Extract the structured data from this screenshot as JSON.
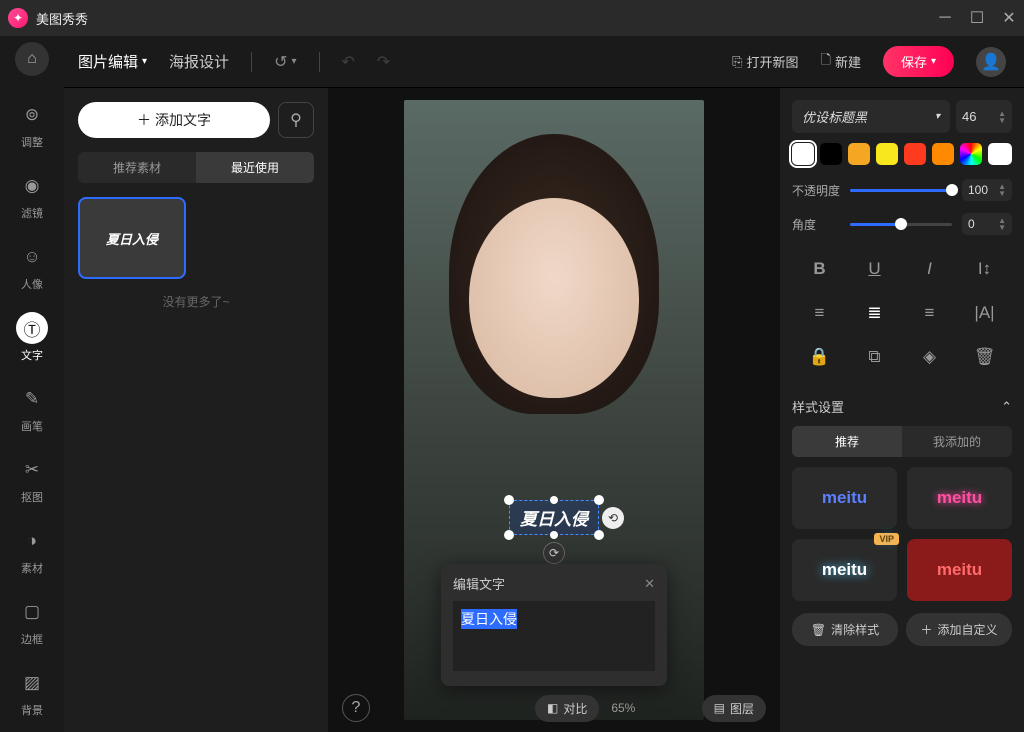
{
  "titlebar": {
    "appName": "美图秀秀"
  },
  "toolbar": {
    "imageEdit": "图片编辑",
    "posterDesign": "海报设计",
    "openNew": "打开新图",
    "newDoc": "新建",
    "save": "保存"
  },
  "sidebar": {
    "items": [
      {
        "label": "调整"
      },
      {
        "label": "滤镜"
      },
      {
        "label": "人像"
      },
      {
        "label": "文字"
      },
      {
        "label": "画笔"
      },
      {
        "label": "抠图"
      },
      {
        "label": "素材"
      },
      {
        "label": "边框"
      },
      {
        "label": "背景"
      }
    ]
  },
  "leftPanel": {
    "addText": "添加文字",
    "tabs": {
      "recommend": "推荐素材",
      "recent": "最近使用"
    },
    "sampleText": "夏日入侵",
    "noMore": "没有更多了~"
  },
  "canvas": {
    "selectedText": "夏日入侵",
    "editTitle": "编辑文字",
    "editValue": "夏日入侵",
    "compare": "对比",
    "zoom": "65%",
    "layers": "图层"
  },
  "rightPanel": {
    "fontName": "优设标题黑",
    "fontSize": "46",
    "colors": [
      "#ffffff",
      "#000000",
      "#f5a623",
      "#f8e71c",
      "#ff3b1f",
      "#ff8a00",
      "rainbow",
      "#ffffff"
    ],
    "opacityLabel": "不透明度",
    "opacityValue": "100",
    "angleLabel": "角度",
    "angleValue": "0",
    "sectionTitle": "样式设置",
    "presetTabs": {
      "recommend": "推荐",
      "mine": "我添加的"
    },
    "presetText": "meitu",
    "vip": "VIP",
    "clearStyle": "清除样式",
    "addCustom": "添加自定义"
  }
}
